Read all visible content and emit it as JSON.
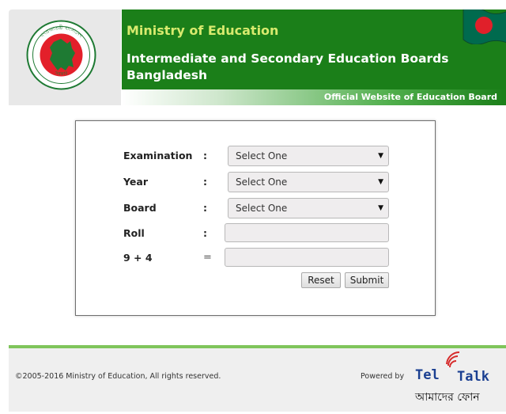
{
  "header": {
    "ministry": "Ministry of Education",
    "boards": "Intermediate and Secondary Education Boards Bangladesh",
    "official": "Official Website of Education Board",
    "seal_top_text": "গণপ্রজাতন্ত্রী বাংলাদেশ",
    "seal_bottom_text": "সরকার"
  },
  "form": {
    "fields": [
      {
        "label": "Examination",
        "sep": ":",
        "value": "Select One"
      },
      {
        "label": "Year",
        "sep": ":",
        "value": "Select One"
      },
      {
        "label": "Board",
        "sep": ":",
        "value": "Select One"
      },
      {
        "label": "Roll",
        "sep": ":",
        "value": ""
      },
      {
        "label": "9 + 4",
        "sep": "=",
        "value": ""
      }
    ],
    "reset_label": "Reset",
    "submit_label": "Submit"
  },
  "footer": {
    "copyright": "©2005-2016 Ministry of Education, All rights reserved.",
    "powered_by": "Powered by",
    "brand_tele": "Tel",
    "brand_talk": "Talk",
    "brand_tagline": "আমাদের ফোন"
  },
  "colors": {
    "banner_green": "#1b7f19",
    "ministry_text": "#d8ea6e",
    "footer_accent": "#7fc55b",
    "brand_blue": "#1a3f91",
    "brand_red": "#d62b2b"
  },
  "icons": {
    "seal": "government-seal-icon",
    "flag": "bangladesh-flag-icon",
    "dropdown": "chevron-down-icon",
    "signal": "signal-waves-icon"
  }
}
